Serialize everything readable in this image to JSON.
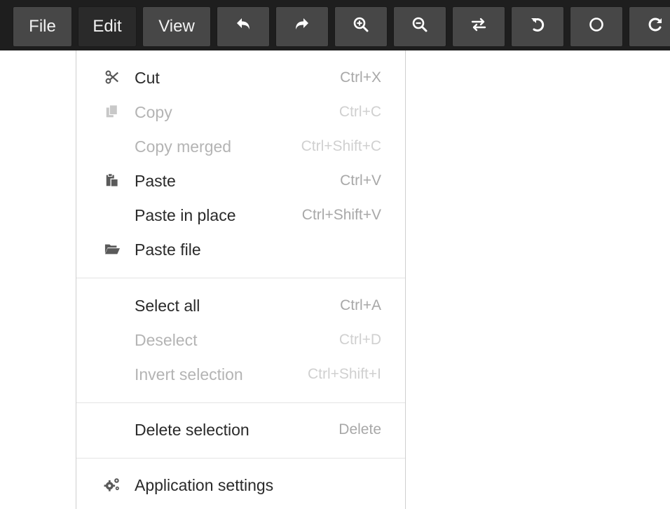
{
  "toolbar": {
    "file_label": "File",
    "edit_label": "Edit",
    "view_label": "View",
    "icons": [
      "undo-icon",
      "redo-icon",
      "zoom-in-icon",
      "zoom-out-icon",
      "swap-icon",
      "rotate-left-icon",
      "circle-icon",
      "rotate-right-icon"
    ]
  },
  "edit_menu": {
    "items": [
      {
        "label": "Cut",
        "shortcut": "Ctrl+X",
        "icon": "scissors-icon",
        "enabled": true
      },
      {
        "label": "Copy",
        "shortcut": "Ctrl+C",
        "icon": "copy-icon",
        "enabled": false
      },
      {
        "label": "Copy merged",
        "shortcut": "Ctrl+Shift+C",
        "icon": "",
        "enabled": false
      },
      {
        "label": "Paste",
        "shortcut": "Ctrl+V",
        "icon": "paste-icon",
        "enabled": true
      },
      {
        "label": "Paste in place",
        "shortcut": "Ctrl+Shift+V",
        "icon": "",
        "enabled": true
      },
      {
        "label": "Paste file",
        "shortcut": "",
        "icon": "folder-open-icon",
        "enabled": true
      },
      {
        "label": "Select all",
        "shortcut": "Ctrl+A",
        "icon": "",
        "enabled": true
      },
      {
        "label": "Deselect",
        "shortcut": "Ctrl+D",
        "icon": "",
        "enabled": false
      },
      {
        "label": "Invert selection",
        "shortcut": "Ctrl+Shift+I",
        "icon": "",
        "enabled": false
      },
      {
        "label": "Delete selection",
        "shortcut": "Delete",
        "icon": "",
        "enabled": true
      },
      {
        "label": "Application settings",
        "shortcut": "",
        "icon": "cogs-icon",
        "enabled": true
      }
    ]
  },
  "colors": {
    "toolbar_background": "#1e1e1e",
    "button_background": "#474747",
    "active_button_background": "#2a2a2a",
    "menu_text": "#2a2a2a",
    "disabled_text": "#b4b4b4",
    "shortcut_text": "#a8a8a8"
  }
}
